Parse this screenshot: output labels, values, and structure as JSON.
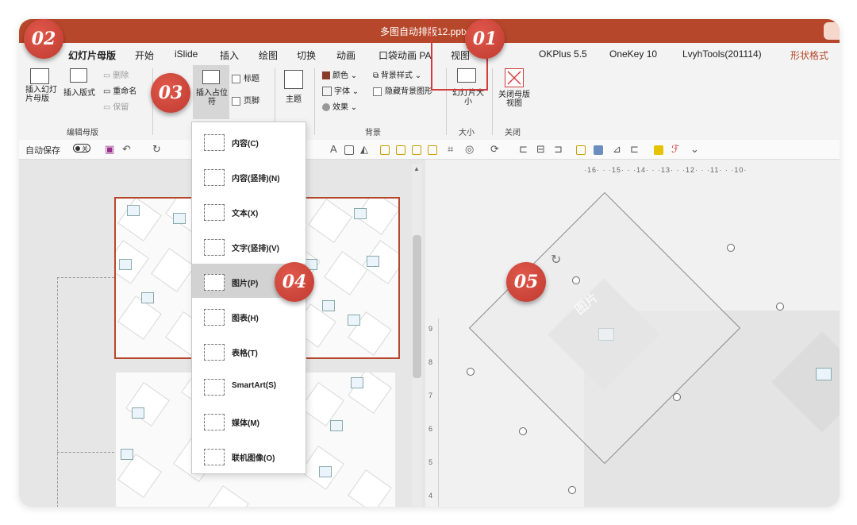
{
  "window": {
    "title": "多图自动排版12.pptx"
  },
  "tabs": [
    {
      "label": "幻灯片母版",
      "active": true
    },
    {
      "label": "开始"
    },
    {
      "label": "iSlide"
    },
    {
      "label": "插入"
    },
    {
      "label": "绘图"
    },
    {
      "label": "切换"
    },
    {
      "label": "动画"
    },
    {
      "label": "口袋动画 PA"
    },
    {
      "label": "视图"
    },
    {
      "label": "OKPlus 5.5"
    },
    {
      "label": "OneKey 10"
    },
    {
      "label": "LvyhTools(201114)"
    },
    {
      "label": "形状格式",
      "accent": true
    }
  ],
  "ribbon": {
    "insert_slide_master": "插入幻灯片母版",
    "insert_layout": "插入版式",
    "delete": "删除",
    "rename": "重命名",
    "preserve": "保留",
    "group_edit_master": "编辑母版",
    "insert_placeholder": "插入占位符",
    "title_check": "标题",
    "footer_check": "页脚",
    "theme": "主题",
    "colors": "颜色",
    "fonts": "字体",
    "effects": "效果",
    "bg_styles": "背景样式",
    "hide_bg": "隐藏背景图形",
    "group_bg": "背景",
    "slide_size": "幻灯片大小",
    "group_size": "大小",
    "close_master": "关闭母版视图",
    "group_close": "关闭"
  },
  "qat": {
    "autosave": "自动保存",
    "toggle": "关"
  },
  "placeholder_menu": [
    {
      "label": "内容(C)",
      "icon": "content-placeholder-icon"
    },
    {
      "label": "内容(竖排)(N)",
      "icon": "vertical-content-placeholder-icon"
    },
    {
      "label": "文本(X)",
      "icon": "text-placeholder-icon"
    },
    {
      "label": "文字(竖排)(V)",
      "icon": "vertical-text-placeholder-icon"
    },
    {
      "label": "图片(P)",
      "icon": "picture-placeholder-icon",
      "highlighted": true
    },
    {
      "label": "图表(H)",
      "icon": "chart-placeholder-icon"
    },
    {
      "label": "表格(T)",
      "icon": "table-placeholder-icon"
    },
    {
      "label": "SmartArt(S)",
      "icon": "smartart-placeholder-icon"
    },
    {
      "label": "媒体(M)",
      "icon": "media-placeholder-icon"
    },
    {
      "label": "联机图像(O)",
      "icon": "online-image-placeholder-icon"
    }
  ],
  "ruler": {
    "horizontal": "·16· · ·15· · ·14· · ·13· · ·12· · ·11· · ·10·",
    "vertical": [
      "9",
      "8",
      "7",
      "6",
      "5",
      "4"
    ]
  },
  "canvas": {
    "watermark_label": "图片"
  },
  "badges": [
    "01",
    "02",
    "03",
    "04",
    "05"
  ],
  "colors": {
    "accent": "#b7472a",
    "badge": "#c9453a"
  }
}
